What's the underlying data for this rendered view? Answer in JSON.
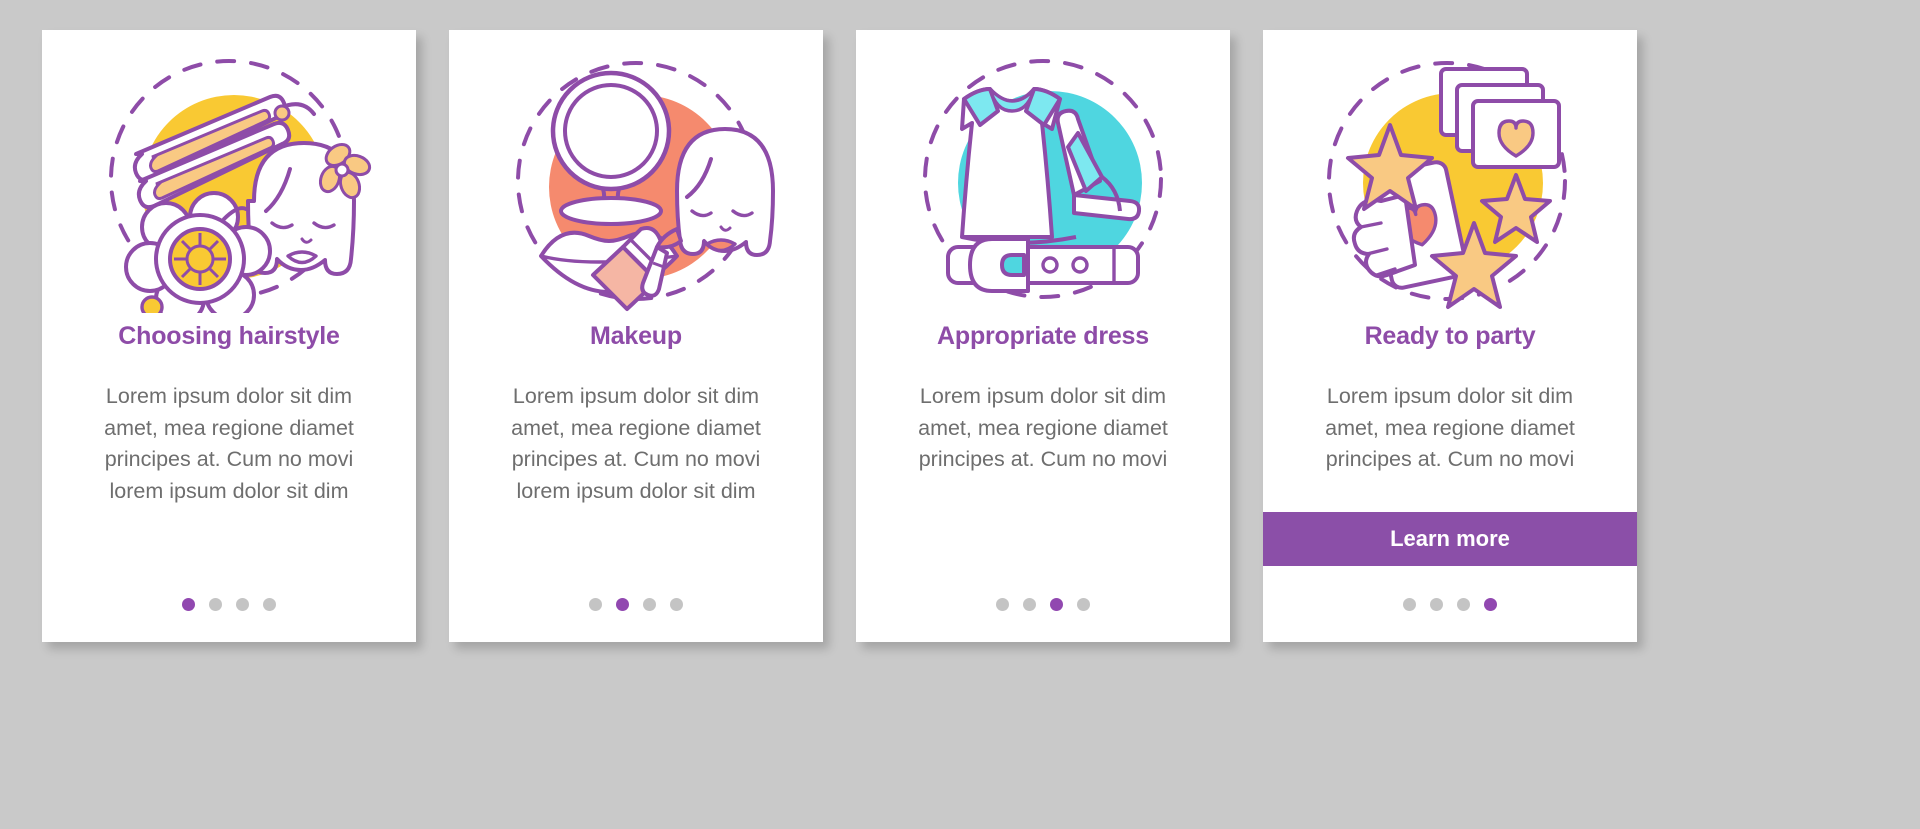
{
  "theme": {
    "background": "#c9c9c9",
    "card_bg": "#ffffff",
    "accent_purple": "#8e4ca8",
    "button_purple": "#8b4fa8",
    "dot_inactive": "#c4c4c4",
    "dot_active": "#9148b0",
    "body_text": "#6e6e6e",
    "yellow": "#f9c933",
    "coral": "#f58a6e",
    "cyan": "#4fd6e0",
    "peach": "#f9c983"
  },
  "shared": {
    "body_text": "Lorem ipsum dolor sit dim amet, mea regione diamet principes at. Cum no movi lorem ipsum dolor sit dim",
    "dot_count": 4
  },
  "cards": [
    {
      "id": "choosing-hairstyle",
      "title": "Choosing hairstyle",
      "body": "Lorem ipsum dolor sit dim amet, mea regione diamet principes at. Cum no movi lorem ipsum dolor sit dim",
      "illustration": "hairstyle-illustration",
      "illustration_accent": "#f9c933",
      "active_dot": 0,
      "has_button": false,
      "button_label": ""
    },
    {
      "id": "makeup",
      "title": "Makeup",
      "body": "Lorem ipsum dolor sit dim amet, mea regione diamet principes at. Cum no movi lorem ipsum dolor sit dim",
      "illustration": "makeup-illustration",
      "illustration_accent": "#f58a6e",
      "active_dot": 1,
      "has_button": false,
      "button_label": ""
    },
    {
      "id": "appropriate-dress",
      "title": "Appropriate dress",
      "body": "Lorem ipsum dolor sit dim amet, mea regione diamet principes at. Cum no movi",
      "illustration": "dress-illustration",
      "illustration_accent": "#4fd6e0",
      "active_dot": 2,
      "has_button": false,
      "button_label": ""
    },
    {
      "id": "ready-to-party",
      "title": "Ready to party",
      "body": "Lorem ipsum dolor sit dim amet, mea regione diamet principes at. Cum no movi",
      "illustration": "party-illustration",
      "illustration_accent": "#f9c933",
      "active_dot": 3,
      "has_button": true,
      "button_label": "Learn more"
    }
  ]
}
